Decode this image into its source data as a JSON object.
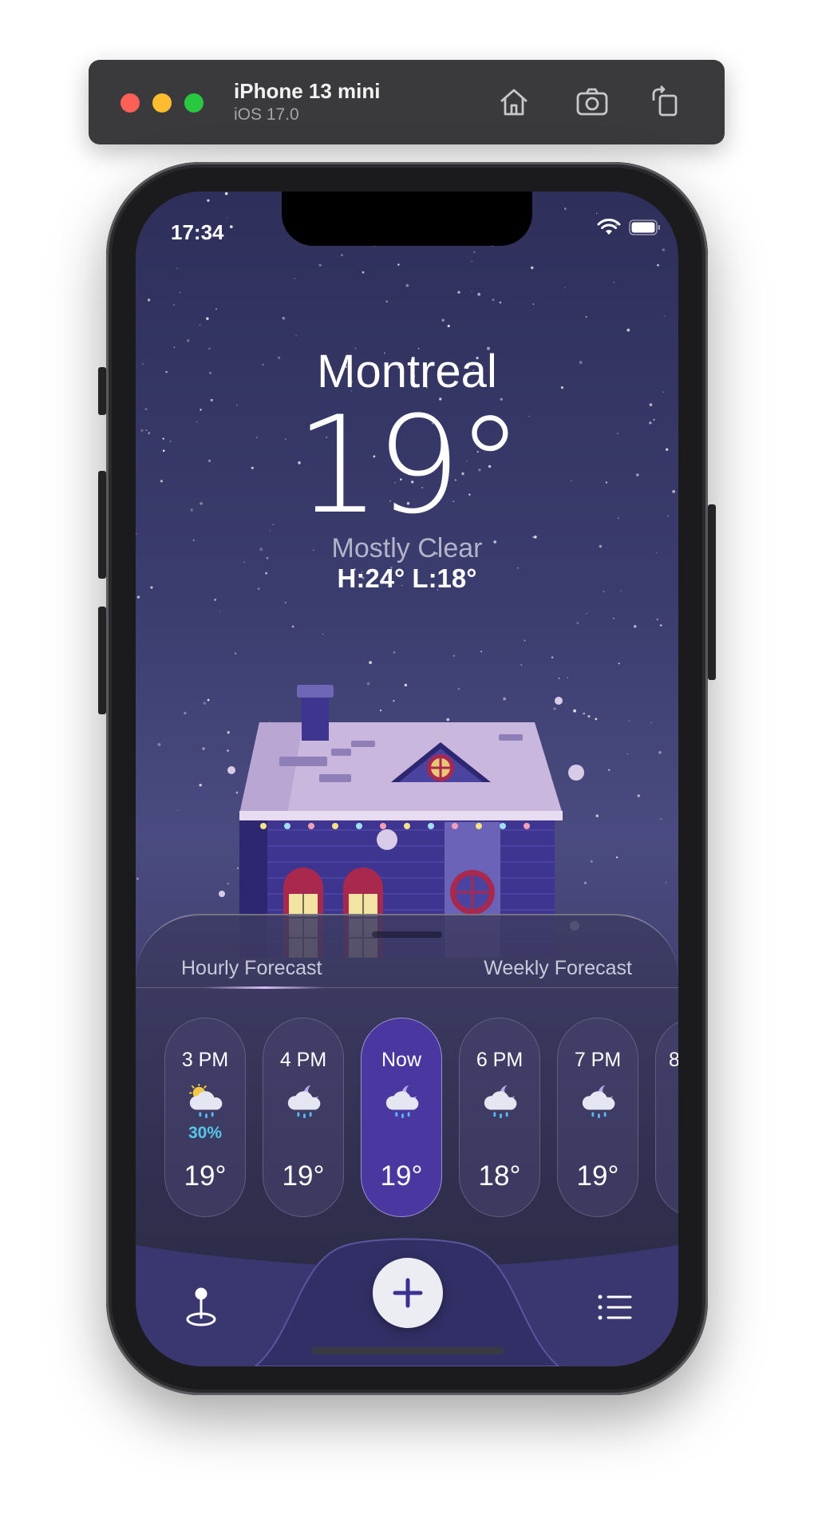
{
  "simulator": {
    "device_name": "iPhone 13 mini",
    "os_version": "iOS 17.0",
    "buttons": [
      "home-icon",
      "screenshot-icon",
      "rotate-icon"
    ]
  },
  "status_bar": {
    "time": "17:34",
    "icons": [
      "wifi-icon",
      "battery-icon"
    ]
  },
  "weather": {
    "city": "Montreal",
    "temperature": "19°",
    "condition": "Mostly Clear",
    "high_low": "H:24° L:18°"
  },
  "forecast": {
    "tabs": {
      "hourly": "Hourly Forecast",
      "weekly": "Weekly Forecast"
    },
    "hours": [
      {
        "time": "3 PM",
        "icon": "sun-cloud-rain-icon",
        "precip": "30%",
        "temp": "19°"
      },
      {
        "time": "4 PM",
        "icon": "moon-cloud-rain-icon",
        "precip": "",
        "temp": "19°"
      },
      {
        "time": "Now",
        "icon": "moon-cloud-rain-icon",
        "precip": "",
        "temp": "19°",
        "active": true
      },
      {
        "time": "6 PM",
        "icon": "moon-cloud-rain-icon",
        "precip": "",
        "temp": "18°"
      },
      {
        "time": "7 PM",
        "icon": "moon-cloud-rain-icon",
        "precip": "",
        "temp": "19°"
      },
      {
        "time": "8",
        "icon": "",
        "precip": "",
        "temp": ""
      }
    ]
  },
  "tab_bar": {
    "left_icon": "map-pin-icon",
    "center_icon": "plus-icon",
    "right_icon": "list-icon"
  },
  "colors": {
    "accent": "#4a37a0",
    "precip": "#56c7e6",
    "sky_top": "#2e2f5a",
    "sheet": "#34324f"
  }
}
